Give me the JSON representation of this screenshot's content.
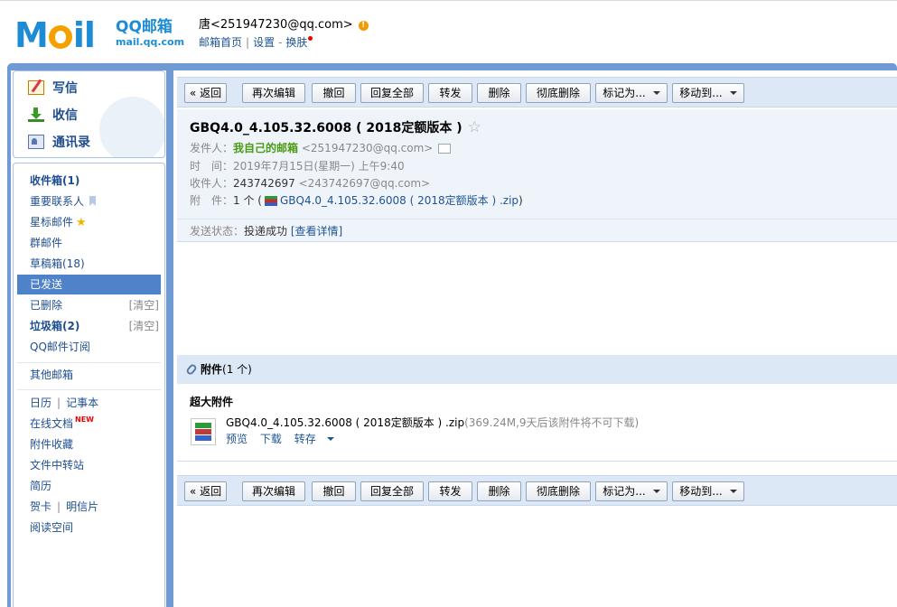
{
  "header": {
    "logo_text": "MoIl",
    "logo_qq": "QQ邮箱",
    "logo_url": "mail.qq.com",
    "user": "唐<251947230@qq.com>",
    "warn_glyph": "!",
    "links": [
      "邮箱首页",
      "设置",
      "换肤"
    ],
    "sep": "|",
    "dash": "-"
  },
  "quick": [
    {
      "label": "写信",
      "icon": "write-icon"
    },
    {
      "label": "收信",
      "icon": "inbox-download-icon"
    },
    {
      "label": "通讯录",
      "icon": "contacts-icon"
    }
  ],
  "sidebar": {
    "inbox": "收件箱(1)",
    "important": "重要联系人",
    "starred": "星标邮件",
    "star_glyph": "★",
    "group": "群邮件",
    "drafts": "草稿箱(18)",
    "sent": "已发送",
    "deleted": "已删除",
    "clear": "[清空]",
    "spam": "垃圾箱(2)",
    "subscription": "QQ邮件订阅",
    "other": "其他邮箱",
    "calendar": "日历",
    "notes": "记事本",
    "docs": "在线文档",
    "new_tag": "NEW",
    "favorites": "附件收藏",
    "transfer": "文件中转站",
    "resume": "简历",
    "card": "贺卡",
    "postcard": "明信片",
    "reading": "阅读空间",
    "bar": "|"
  },
  "toolbar": {
    "back": "« 返回",
    "reedit": "再次编辑",
    "recall": "撤回",
    "reply_all": "回复全部",
    "forward": "转发",
    "delete": "删除",
    "delete_perm": "彻底删除",
    "mark": "标记为...",
    "move": "移动到..."
  },
  "mail": {
    "subject": "GBQ4.0_4.105.32.6008 ( 2018定额版本 )",
    "star": "☆",
    "from_label": "发件人：",
    "from_name": "我自己的邮箱",
    "from_addr": "<251947230@qq.com>",
    "time_label": "时　间：",
    "time": "2019年7月15日(星期一) 上午9:40",
    "to_label": "收件人：",
    "to_name": "243742697",
    "to_addr": "<243742697@qq.com>",
    "att_label": "附　件：",
    "att_count": "1 个 (",
    "att_file": "GBQ4.0_4.105.32.6008 ( 2018定额版本 ) .zip",
    "att_close": ")",
    "status_label": "发送状态：",
    "status": "投递成功",
    "status_detail": "[查看详情]"
  },
  "attachment": {
    "heading": "附件",
    "count": "(1 个)",
    "title": "超大附件",
    "filename": "GBQ4.0_4.105.32.6008 ( 2018定额版本 ) .zip",
    "info": "(369.24M,9天后该附件将不可下载)",
    "preview": "预览",
    "download": "下载",
    "save": "转存"
  },
  "colors": {
    "accent": "#6f9ad4",
    "link": "#1e5494",
    "active": "#4f83c9",
    "green": "#4a9a14"
  }
}
